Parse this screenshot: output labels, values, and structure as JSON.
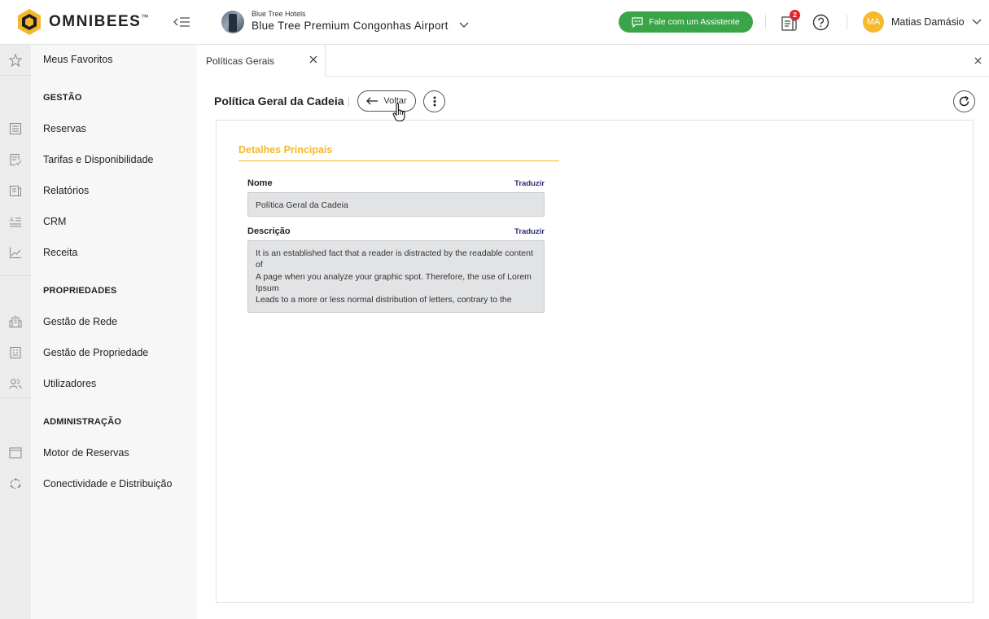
{
  "brand": {
    "name": "OMNIBEES",
    "tm": "™"
  },
  "hotel": {
    "group": "Blue Tree Hotels",
    "name": "Blue Tree Premium Congonhas Airport"
  },
  "header": {
    "assistant_label": "Fale com um Assistente",
    "notification_count": "2",
    "user_initials": "MA",
    "user_name": "Matias Damásio"
  },
  "nav": {
    "favorites": "Meus Favoritos",
    "sections": [
      {
        "title": "GESTÃO",
        "items": [
          "Reservas",
          "Tarifas e Disponibilidade",
          "Relatórios",
          "CRM",
          "Receita"
        ]
      },
      {
        "title": "PROPRIEDADES",
        "items": [
          "Gestão de Rede",
          "Gestão de Propriedade",
          "Utilizadores"
        ]
      },
      {
        "title": "ADMINISTRAÇÃO",
        "items": [
          "Motor de Reservas",
          "Conectividade e Distribuição"
        ]
      }
    ]
  },
  "tabs": [
    {
      "label": "Políticas Gerais"
    }
  ],
  "page": {
    "title": "Política Geral da Cadeia",
    "back_label": "Voltar"
  },
  "form": {
    "section_title": "Detalhes Principais",
    "translate_label": "Traduzir",
    "name": {
      "label": "Nome",
      "value": "Política Geral da Cadeia"
    },
    "description": {
      "label": "Descrição",
      "value": "It is an established fact that a reader is distracted by the readable content of\nA page when you analyze your graphic spot. Therefore, the use of Lorem Ipsum\nLeads to a more or less normal distribution of letters, contrary to the"
    }
  },
  "colors": {
    "accent": "#f5b72b",
    "assistant": "#3aa548",
    "badge": "#e3262b",
    "translate": "#2b2d6e"
  }
}
